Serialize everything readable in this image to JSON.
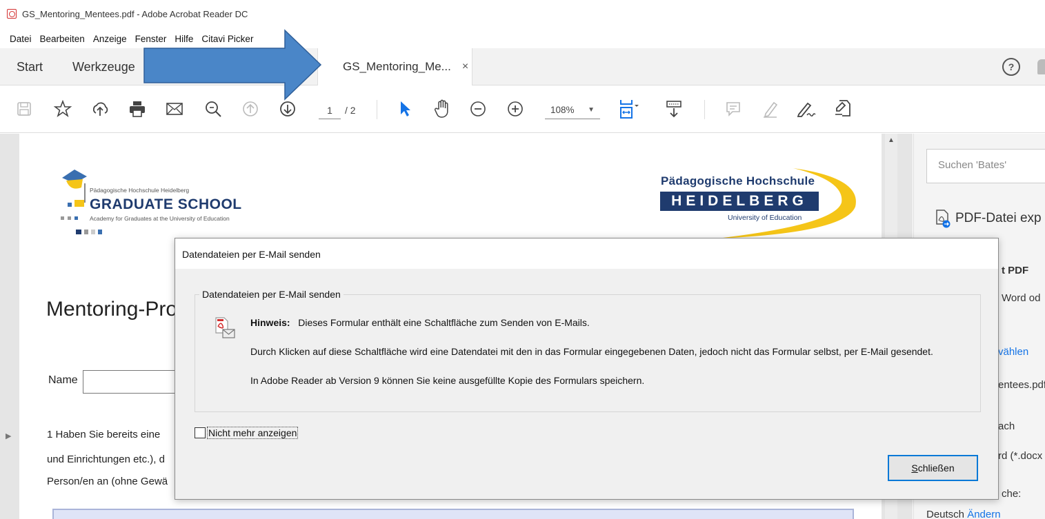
{
  "window": {
    "title": "GS_Mentoring_Mentees.pdf - Adobe Acrobat Reader DC"
  },
  "menu": [
    "Datei",
    "Bearbeiten",
    "Anzeige",
    "Fenster",
    "Hilfe",
    "Citavi Picker"
  ],
  "tabs": {
    "start": "Start",
    "tools": "Werkzeuge",
    "document": "GS_Mentoring_Me...",
    "close": "×"
  },
  "toolbar": {
    "page_current": "1",
    "page_total": "/ 2",
    "zoom": "108%"
  },
  "document": {
    "gs_logo": {
      "small": "Pädagogische Hochschule Heidelberg",
      "big": "GRADUATE SCHOOL",
      "sub": "Academy for Graduates at the University of Education"
    },
    "ph_logo": {
      "top": "Pädagogische Hochschule",
      "box": "HEIDELBERG",
      "sub": "University of Education"
    },
    "heading": "Mentoring-Prog",
    "name_label": "Name",
    "lines": [
      "1 Haben Sie bereits eine",
      "und Einrichtungen etc.), d",
      "Person/en an (ohne Gewä"
    ]
  },
  "right_pane": {
    "search_placeholder": "Suchen 'Bates'",
    "export_label": "PDF-Datei exp",
    "convert_title": "t PDF",
    "convert_desc": "Word od",
    "select_link": "vählen",
    "file_name": "entees.pdf",
    "target": "ach",
    "format": "rd (*.docx",
    "lang_label": "che:",
    "lang_value": "Deutsch",
    "lang_change": "Ändern"
  },
  "dialog": {
    "title": "Datendateien per E-Mail senden",
    "group_label": "Datendateien per E-Mail senden",
    "hint_label": "Hinweis:",
    "hint_text": "Dieses Formular enthält eine Schaltfläche zum Senden von E-Mails.",
    "line2": "Durch Klicken auf diese Schaltfläche wird eine Datendatei mit den in das Formular eingegebenen Daten, jedoch nicht das Formular selbst, per E-Mail gesendet.",
    "line3": "In Adobe Reader ab Version 9 können Sie keine ausgefüllte Kopie des Formulars speichern.",
    "checkbox_label": "Nicht mehr anzeigen",
    "close_button_mnemonic": "S",
    "close_button_rest": "chließen"
  },
  "colors": {
    "accent": "#1473e6",
    "arrow": "#4a86c8",
    "brand_navy": "#1f3b6e",
    "brand_yellow": "#f5c518"
  }
}
